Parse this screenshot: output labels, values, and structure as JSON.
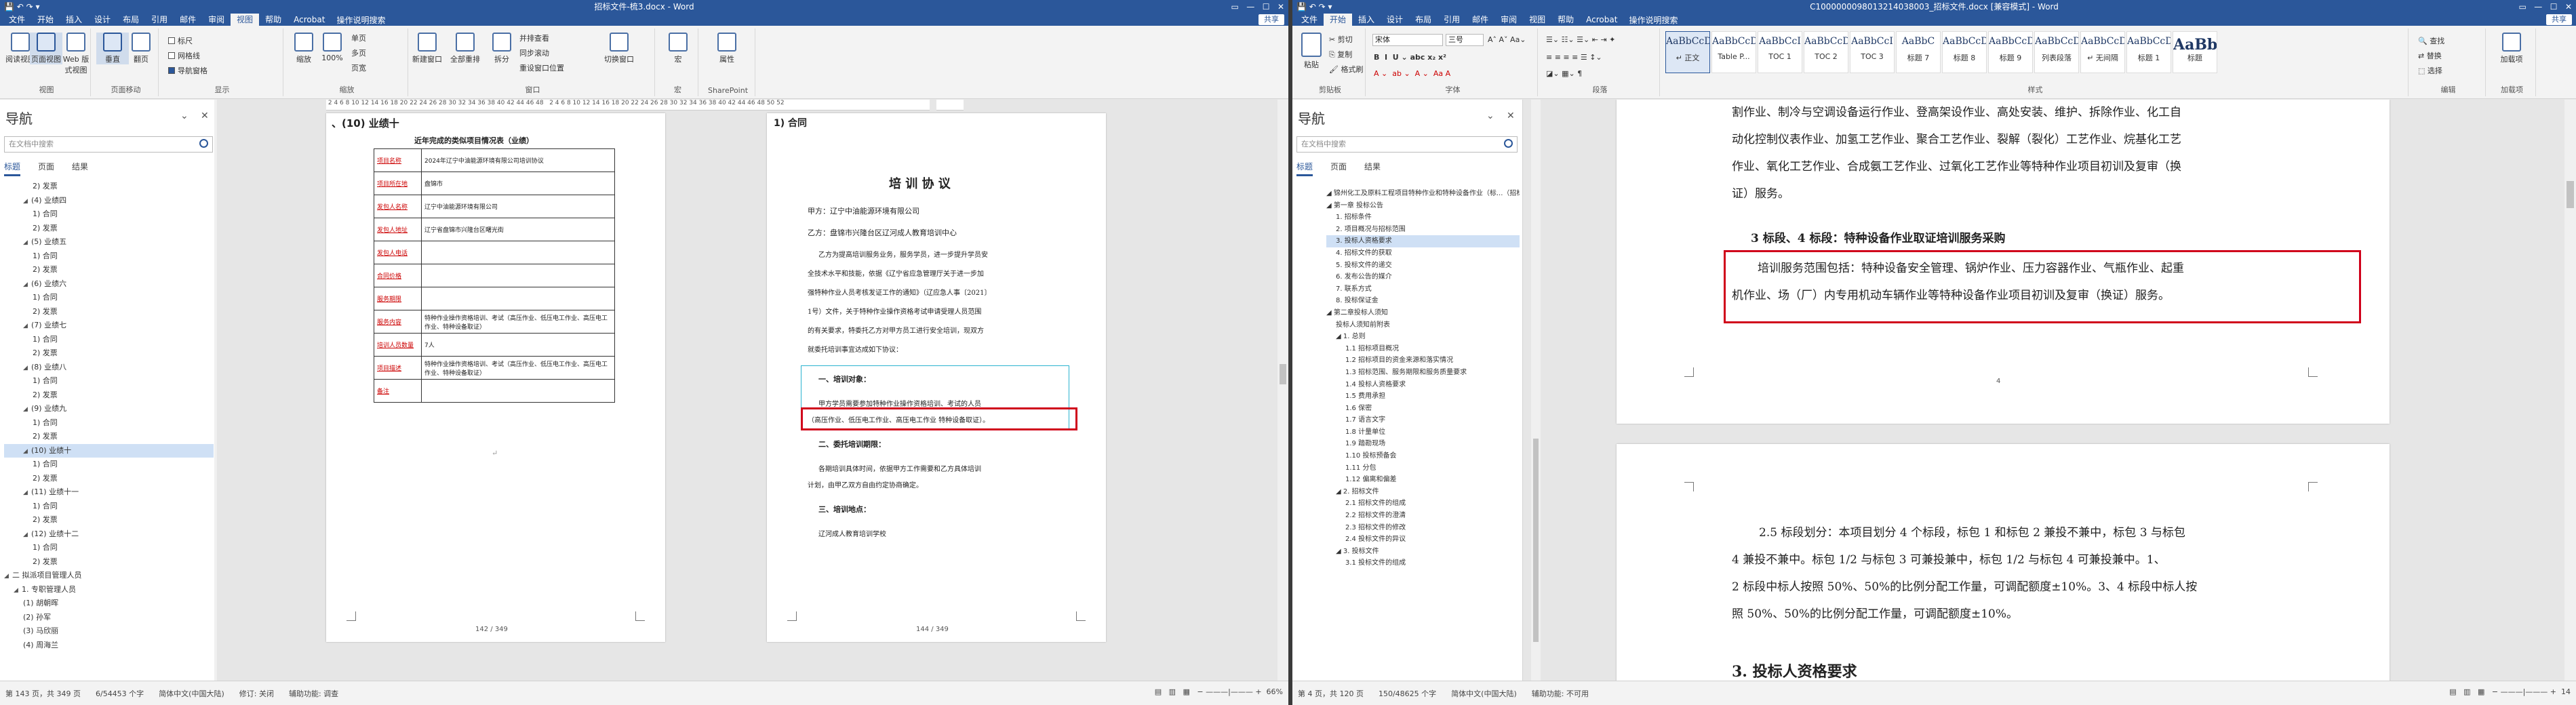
{
  "left": {
    "title": "招标文件-梳3.docx - Word",
    "share": "共享",
    "menu": [
      "文件",
      "开始",
      "插入",
      "设计",
      "布局",
      "引用",
      "邮件",
      "审阅",
      "视图",
      "帮助",
      "Acrobat"
    ],
    "menu_active": "视图",
    "tell": "操作说明搜索",
    "ribbon": {
      "groups": [
        "视图",
        "显示",
        "缩放",
        "窗口",
        "宏",
        "SharePoint"
      ],
      "view_btns": [
        "阅读视图",
        "页面视图",
        "Web 版式视图"
      ],
      "page_move": [
        "垂直",
        "翻页"
      ],
      "show_checks": [
        "标尺",
        "网格线",
        "导航窗格"
      ],
      "zoom_btns": [
        "缩放",
        "100%",
        "单页",
        "多页",
        "页宽"
      ],
      "window_btns": [
        "新建窗口",
        "全部重排",
        "拆分",
        "并排查看",
        "同步滚动",
        "重设窗口位置",
        "切换窗口"
      ],
      "macro": "宏",
      "props": "属性",
      "page_move_label": "页面移动"
    },
    "nav": {
      "title": "导航",
      "search": "在文档中搜索",
      "tabs": [
        "标题",
        "页面",
        "结果"
      ],
      "items": [
        {
          "t": "2) 发票",
          "lv": 4
        },
        {
          "t": "(4)  业绩四",
          "lv": 3,
          "ar": "◢"
        },
        {
          "t": "1) 合同",
          "lv": 4
        },
        {
          "t": "2) 发票",
          "lv": 4
        },
        {
          "t": "(5)  业绩五",
          "lv": 3,
          "ar": "◢"
        },
        {
          "t": "1) 合同",
          "lv": 4
        },
        {
          "t": "2) 发票",
          "lv": 4
        },
        {
          "t": "(6)  业绩六",
          "lv": 3,
          "ar": "◢"
        },
        {
          "t": "1) 合同",
          "lv": 4
        },
        {
          "t": "2) 发票",
          "lv": 4
        },
        {
          "t": "(7)  业绩七",
          "lv": 3,
          "ar": "◢"
        },
        {
          "t": "1) 合同",
          "lv": 4
        },
        {
          "t": "2) 发票",
          "lv": 4
        },
        {
          "t": "(8)  业绩八",
          "lv": 3,
          "ar": "◢"
        },
        {
          "t": "1) 合同",
          "lv": 4
        },
        {
          "t": "2) 发票",
          "lv": 4
        },
        {
          "t": "(9)  业绩九",
          "lv": 3,
          "ar": "◢"
        },
        {
          "t": "1) 合同",
          "lv": 4
        },
        {
          "t": "2) 发票",
          "lv": 4
        },
        {
          "t": "(10)  业绩十",
          "lv": 3,
          "ar": "◢",
          "sel": true
        },
        {
          "t": "1) 合同",
          "lv": 4
        },
        {
          "t": "2) 发票",
          "lv": 4
        },
        {
          "t": "(11)  业绩十一",
          "lv": 3,
          "ar": "◢"
        },
        {
          "t": "1) 合同",
          "lv": 4
        },
        {
          "t": "2) 发票",
          "lv": 4
        },
        {
          "t": "(12)  业绩十二",
          "lv": 3,
          "ar": "◢"
        },
        {
          "t": "1) 合同",
          "lv": 4
        },
        {
          "t": "2) 发票",
          "lv": 4
        },
        {
          "t": "二  拟派项目管理人员",
          "lv": 1,
          "ar": "◢"
        },
        {
          "t": "1. 专职管理人员",
          "lv": 2,
          "ar": "◢"
        },
        {
          "t": "(1)  胡朝晖",
          "lv": 3
        },
        {
          "t": "(2)  孙军",
          "lv": 3
        },
        {
          "t": "(3)  马欣丽",
          "lv": 3
        },
        {
          "t": "(4)  周海兰",
          "lv": 3
        }
      ]
    },
    "page1": {
      "heading": "、(10)  业绩十",
      "table_title": "近年完成的类似项目情况表（业绩）",
      "rows": [
        [
          "项目名称",
          "2024年辽宁中油能源环境有限公司培训协议"
        ],
        [
          "项目所在地",
          "盘锦市"
        ],
        [
          "发包人名称",
          "辽宁中油能源环境有限公司"
        ],
        [
          "发包人地址",
          "辽宁省盘锦市兴隆台区曙光街"
        ],
        [
          "发包人电话",
          ""
        ],
        [
          "合同价格",
          ""
        ],
        [
          "服务期限",
          ""
        ],
        [
          "服务内容",
          "特种作业操作资格培训、考试（高压作业、低压电工作业、高压电工作业、特种设备取证）"
        ],
        [
          "培训人员数量",
          "7人"
        ],
        [
          "项目描述",
          "特种作业操作资格培训、考试（高压作业、低压电工作业、高压电工作业、特种设备取证）"
        ],
        [
          "备注",
          ""
        ]
      ],
      "pnum": "142 / 349"
    },
    "page2": {
      "heading": "1)  合同",
      "title": "培 训 协 议",
      "party_a": "甲方：辽宁中油能源环境有限公司",
      "party_b": "乙方：盘锦市兴隆台区辽河成人教育培训中心",
      "para": [
        "乙方为提高培训服务业务，服务学员，进一步提升学员安",
        "全技术水平和技能，依据《辽宁省应急管理厅关于进一步加",
        "强特种作业人员考核发证工作的通知》（辽应急人事〔2021〕",
        "1号）文件，关于特种作业操作资格考试申请受理人员范围",
        "的有关要求，特委托乙方对甲方员工进行安全培训，现双方",
        "就委托培训事宜达成如下协议："
      ],
      "sec1": "一、培训对象：",
      "sec1_body": [
        "甲方学员需要参加特种作业操作资格培训、考试的人员",
        "（高压作业、低压电工作业、高压电工作业 特种设备取证）。"
      ],
      "sec2": "二、委托培训期限：",
      "sec2_body": [
        "各期培训具体时间，依据甲方工作需要和乙方具体培训",
        "计划，由甲乙双方自由约定协商确定。"
      ],
      "sec3": "三、培训地点：",
      "sec3_body": "辽河成人教育培训学校",
      "pnum": "144 / 349"
    },
    "status": [
      "第 143 页，共 349 页",
      "6/54453 个字",
      "简体中文(中国大陆)",
      "修订: 关闭",
      "辅助功能: 调查"
    ],
    "zoom": "66%"
  },
  "right": {
    "title": "C1000000098013214038003_招标文件.docx [兼容模式] - Word",
    "share": "共享",
    "menu": [
      "文件",
      "开始",
      "插入",
      "设计",
      "布局",
      "引用",
      "邮件",
      "审阅",
      "视图",
      "帮助",
      "Acrobat"
    ],
    "menu_active": "开始",
    "tell": "操作说明搜索",
    "ribbon": {
      "groups": [
        "剪贴板",
        "字体",
        "段落",
        "样式",
        "编辑",
        "加载项"
      ],
      "paste": "粘贴",
      "clip": [
        "剪切",
        "复制",
        "格式刷"
      ],
      "font_name": "宋体",
      "font_size": "三号",
      "styles": [
        {
          "pv": "AaBbCcDt",
          "n": "↵ 正文"
        },
        {
          "pv": "AaBbCcDt",
          "n": "Table P..."
        },
        {
          "pv": "AaBbCcI",
          "n": "TOC 1"
        },
        {
          "pv": "AaBbCcDt",
          "n": "TOC 2"
        },
        {
          "pv": "AaBbCcI",
          "n": "TOC 3"
        },
        {
          "pv": "AaBbC",
          "n": "标题 7"
        },
        {
          "pv": "AaBbCcDt",
          "n": "标题 8"
        },
        {
          "pv": "AaBbCcDt",
          "n": "标题 9"
        },
        {
          "pv": "AaBbCcDt",
          "n": "列表段落"
        },
        {
          "pv": "AaBbCcDt",
          "n": "↵ 无间隔"
        },
        {
          "pv": "AaBbCcDt",
          "n": "标题 1"
        },
        {
          "pv": "AaBb",
          "n": "标题"
        }
      ],
      "edit": [
        "查找",
        "替换",
        "选择"
      ],
      "addin": "加载项"
    },
    "nav": {
      "title": "导航",
      "search": "在文档中搜索",
      "tabs": [
        "标题",
        "页面",
        "结果"
      ],
      "items": [
        {
          "t": "◢ 锦州化工及原料工程项目特种作业和特种设备作业（标...（招标人）招标编号: 42718-C-...",
          "lv": 1
        },
        {
          "t": "◢ 第一章 投标公告",
          "lv": 1
        },
        {
          "t": "1. 招标条件",
          "lv": 2
        },
        {
          "t": "2. 项目概况与招标范围",
          "lv": 2
        },
        {
          "t": "3. 投标人资格要求",
          "lv": 2,
          "sel": true
        },
        {
          "t": "4. 招标文件的获取",
          "lv": 2
        },
        {
          "t": "5. 投标文件的递交",
          "lv": 2
        },
        {
          "t": "6. 发布公告的媒介",
          "lv": 2
        },
        {
          "t": "7. 联系方式",
          "lv": 2
        },
        {
          "t": "8. 投标保证金",
          "lv": 2
        },
        {
          "t": "◢ 第二章投标人须知",
          "lv": 1
        },
        {
          "t": "投标人须知前附表",
          "lv": 2
        },
        {
          "t": "◢ 1. 总则",
          "lv": 2
        },
        {
          "t": "1.1 招标项目概况",
          "lv": 3
        },
        {
          "t": "1.2 招标项目的资金来源和落实情况",
          "lv": 3
        },
        {
          "t": "1.3 招标范围、服务期限和服务质量要求",
          "lv": 3
        },
        {
          "t": "1.4 投标人资格要求",
          "lv": 3
        },
        {
          "t": "1.5 费用承担",
          "lv": 3
        },
        {
          "t": "1.6 保密",
          "lv": 3
        },
        {
          "t": "1.7 语言文字",
          "lv": 3
        },
        {
          "t": "1.8 计量单位",
          "lv": 3
        },
        {
          "t": "1.9 踏勘现场",
          "lv": 3
        },
        {
          "t": "1.10 投标预备会",
          "lv": 3
        },
        {
          "t": "1.11 分包",
          "lv": 3
        },
        {
          "t": "1.12 偏离和偏差",
          "lv": 3
        },
        {
          "t": "◢ 2. 招标文件",
          "lv": 2
        },
        {
          "t": "2.1 招标文件的组成",
          "lv": 3
        },
        {
          "t": "2.2 招标文件的澄清",
          "lv": 3
        },
        {
          "t": "2.3 招标文件的修改",
          "lv": 3
        },
        {
          "t": "2.4 投标文件的异议",
          "lv": 3
        },
        {
          "t": "◢ 3. 投标文件",
          "lv": 2
        },
        {
          "t": "3.1 投标文件的组成",
          "lv": 3
        }
      ]
    },
    "pageA": {
      "lines": [
        "割作业、制冷与空调设备运行作业、登高架设作业、高处安装、维护、拆除作业、化工自",
        "动化控制仪表作业、加氢工艺作业、聚合工艺作业、裂解（裂化）工艺作业、烷基化工艺",
        "作业、氧化工艺作业、合成氨工艺作业、过氧化工艺作业等特种作业项目初训及复审（换",
        "证）服务。"
      ],
      "sec": "3 标段、4 标段：特种设备作业取证培训服务采购",
      "box": [
        "培训服务范围包括：特种设备安全管理、锅炉作业、压力容器作业、气瓶作业、起重",
        "机作业、场（厂）内专用机动车辆作业等特种设备作业项目初训及复审（换证）服务。"
      ],
      "pnum": "4"
    },
    "pageB": {
      "lines": [
        "2.5  标段划分：本项目划分 4 个标段，标包 1 和标包 2 兼投不兼中，标包 3 与标包",
        "4 兼投不兼中。标包 1/2 与标包 3 可兼投兼中，标包 1/2 与标包 4 可兼投兼中。1、",
        "2 标段中标人按照 50%、50%的比例分配工作量，可调配额度±10%。3、4 标段中标人按",
        "照 50%、50%的比例分配工作量，可调配额度±10%。"
      ],
      "sec": "3.  投标人资格要求"
    },
    "status": [
      "第 4 页，共 120 页",
      "150/48625 个字",
      "简体中文(中国大陆)",
      "辅助功能: 不可用"
    ],
    "zoom": "14"
  }
}
